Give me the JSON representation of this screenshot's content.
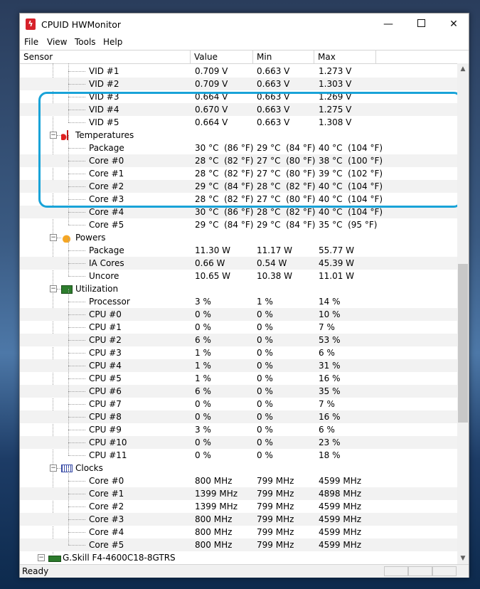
{
  "window": {
    "title": "CPUID HWMonitor",
    "minimize": "—",
    "close": "✕"
  },
  "menu": [
    "File",
    "View",
    "Tools",
    "Help"
  ],
  "columns": [
    "Sensor",
    "Value",
    "Min",
    "Max"
  ],
  "vid_rows": [
    {
      "name": "VID #1",
      "value": "0.709 V",
      "min": "0.663 V",
      "max": "1.273 V"
    },
    {
      "name": "VID #2",
      "value": "0.709 V",
      "min": "0.663 V",
      "max": "1.303 V"
    },
    {
      "name": "VID #3",
      "value": "0.664 V",
      "min": "0.663 V",
      "max": "1.269 V"
    },
    {
      "name": "VID #4",
      "value": "0.670 V",
      "min": "0.663 V",
      "max": "1.275 V"
    },
    {
      "name": "VID #5",
      "value": "0.664 V",
      "min": "0.663 V",
      "max": "1.308 V"
    }
  ],
  "temperatures": {
    "label": "Temperatures",
    "rows": [
      {
        "name": "Package",
        "value": "30 °C  (86 °F)",
        "min": "29 °C  (84 °F)",
        "max": "40 °C  (104 °F)"
      },
      {
        "name": "Core #0",
        "value": "28 °C  (82 °F)",
        "min": "27 °C  (80 °F)",
        "max": "38 °C  (100 °F)"
      },
      {
        "name": "Core #1",
        "value": "28 °C  (82 °F)",
        "min": "27 °C  (80 °F)",
        "max": "39 °C  (102 °F)"
      },
      {
        "name": "Core #2",
        "value": "29 °C  (84 °F)",
        "min": "28 °C  (82 °F)",
        "max": "40 °C  (104 °F)"
      },
      {
        "name": "Core #3",
        "value": "28 °C  (82 °F)",
        "min": "27 °C  (80 °F)",
        "max": "40 °C  (104 °F)"
      },
      {
        "name": "Core #4",
        "value": "30 °C  (86 °F)",
        "min": "28 °C  (82 °F)",
        "max": "40 °C  (104 °F)"
      },
      {
        "name": "Core #5",
        "value": "29 °C  (84 °F)",
        "min": "29 °C  (84 °F)",
        "max": "35 °C  (95 °F)"
      }
    ]
  },
  "powers": {
    "label": "Powers",
    "rows": [
      {
        "name": "Package",
        "value": "11.30 W",
        "min": "11.17 W",
        "max": "55.77 W"
      },
      {
        "name": "IA Cores",
        "value": "0.66 W",
        "min": "0.54 W",
        "max": "45.39 W"
      },
      {
        "name": "Uncore",
        "value": "10.65 W",
        "min": "10.38 W",
        "max": "11.01 W"
      }
    ]
  },
  "utilization": {
    "label": "Utilization",
    "rows": [
      {
        "name": "Processor",
        "value": "3 %",
        "min": "1 %",
        "max": "14 %"
      },
      {
        "name": "CPU #0",
        "value": "0 %",
        "min": "0 %",
        "max": "10 %"
      },
      {
        "name": "CPU #1",
        "value": "0 %",
        "min": "0 %",
        "max": "7 %"
      },
      {
        "name": "CPU #2",
        "value": "6 %",
        "min": "0 %",
        "max": "53 %"
      },
      {
        "name": "CPU #3",
        "value": "1 %",
        "min": "0 %",
        "max": "6 %"
      },
      {
        "name": "CPU #4",
        "value": "1 %",
        "min": "0 %",
        "max": "31 %"
      },
      {
        "name": "CPU #5",
        "value": "1 %",
        "min": "0 %",
        "max": "16 %"
      },
      {
        "name": "CPU #6",
        "value": "6 %",
        "min": "0 %",
        "max": "35 %"
      },
      {
        "name": "CPU #7",
        "value": "0 %",
        "min": "0 %",
        "max": "7 %"
      },
      {
        "name": "CPU #8",
        "value": "0 %",
        "min": "0 %",
        "max": "16 %"
      },
      {
        "name": "CPU #9",
        "value": "3 %",
        "min": "0 %",
        "max": "6 %"
      },
      {
        "name": "CPU #10",
        "value": "0 %",
        "min": "0 %",
        "max": "23 %"
      },
      {
        "name": "CPU #11",
        "value": "0 %",
        "min": "0 %",
        "max": "18 %"
      }
    ]
  },
  "clocks": {
    "label": "Clocks",
    "rows": [
      {
        "name": "Core #0",
        "value": "800 MHz",
        "min": "799 MHz",
        "max": "4599 MHz"
      },
      {
        "name": "Core #1",
        "value": "1399 MHz",
        "min": "799 MHz",
        "max": "4898 MHz"
      },
      {
        "name": "Core #2",
        "value": "1399 MHz",
        "min": "799 MHz",
        "max": "4599 MHz"
      },
      {
        "name": "Core #3",
        "value": "800 MHz",
        "min": "799 MHz",
        "max": "4599 MHz"
      },
      {
        "name": "Core #4",
        "value": "800 MHz",
        "min": "799 MHz",
        "max": "4599 MHz"
      },
      {
        "name": "Core #5",
        "value": "800 MHz",
        "min": "799 MHz",
        "max": "4599 MHz"
      }
    ]
  },
  "memory_device": "G.Skill F4-4600C18-8GTRS",
  "status": "Ready",
  "colors": {
    "highlight": "#19a3d8",
    "app_icon": "#d6212a"
  }
}
